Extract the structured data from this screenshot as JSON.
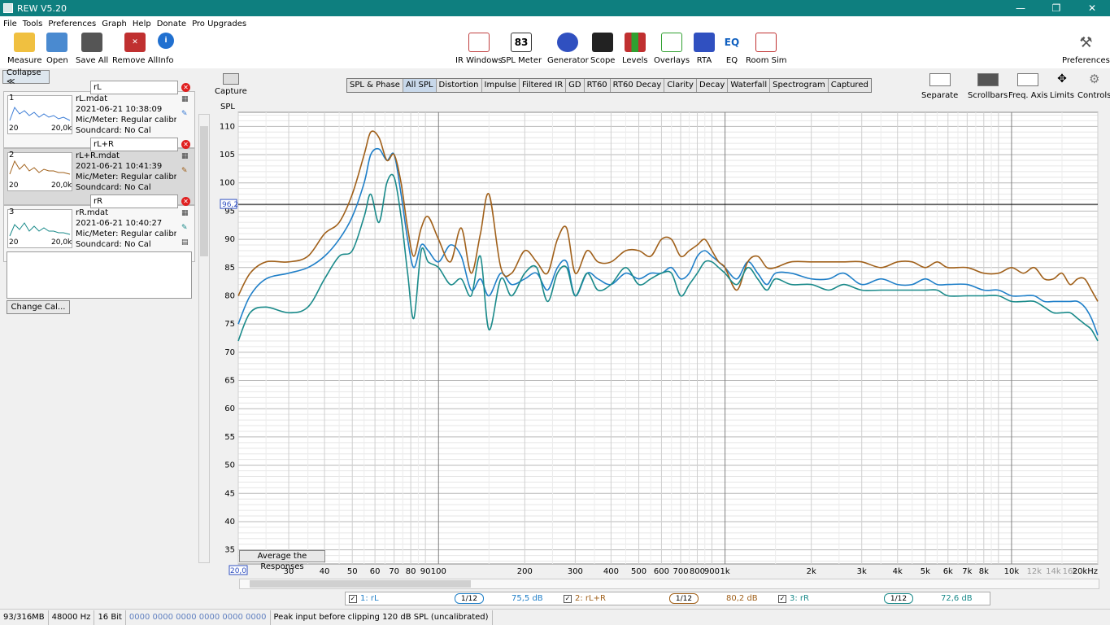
{
  "window": {
    "title": "REW V5.20",
    "min": "—",
    "max": "❐",
    "close": "✕"
  },
  "menu": [
    "File",
    "Tools",
    "Preferences",
    "Graph",
    "Help",
    "Donate",
    "Pro Upgrades"
  ],
  "toolbar_left": [
    {
      "label": "Measure",
      "icon": "measure-icon",
      "color": "#f0c040"
    },
    {
      "label": "Open",
      "icon": "folder-icon",
      "color": "#4a8ad0"
    },
    {
      "label": "Save All",
      "icon": "floppy-icon",
      "color": "#555555"
    },
    {
      "label": "Remove All",
      "icon": "remove-icon",
      "color": "#c03030"
    },
    {
      "label": "Info",
      "icon": "info-icon",
      "color": "#2070d0"
    }
  ],
  "toolbar_mid": [
    {
      "label": "IR Windows",
      "icon": "ir-windows-icon",
      "color": "#c04040"
    },
    {
      "label": "SPL Meter",
      "icon": "spl-meter-icon",
      "color": "#333333",
      "text": "83"
    },
    {
      "label": "Generator",
      "icon": "generator-icon",
      "color": "#3050c0"
    },
    {
      "label": "Scope",
      "icon": "scope-icon",
      "color": "#222222"
    },
    {
      "label": "Levels",
      "icon": "levels-icon",
      "color": "#c03030"
    },
    {
      "label": "Overlays",
      "icon": "overlays-icon",
      "color": "#30a030"
    },
    {
      "label": "RTA",
      "icon": "rta-icon",
      "color": "#3050c0"
    },
    {
      "label": "EQ",
      "icon": "eq-icon",
      "color": "#1060c0",
      "text": "EQ"
    },
    {
      "label": "Room Sim",
      "icon": "room-sim-icon",
      "color": "#c03030"
    }
  ],
  "toolbar_right": {
    "label": "Preferences",
    "icon": "wrench-icon"
  },
  "left_panel": {
    "collapse_label": "Collapse ≪",
    "measurements": [
      {
        "num": "1",
        "name_input": "rL",
        "file": "rL.mdat",
        "date": "2021-06-21 10:38:09",
        "mic": "Mic/Meter: Regular calibratior",
        "sound": "Soundcard: No Cal",
        "color": "#3a7bd5",
        "t20": "20",
        "t20k": "20,0k"
      },
      {
        "num": "2",
        "name_input": "rL+R",
        "file": "rL+R.mdat",
        "date": "2021-06-21 10:41:39",
        "mic": "Mic/Meter: Regular calibratior",
        "sound": "Soundcard: No Cal",
        "color": "#a0601a",
        "t20": "20",
        "t20k": "20,0k"
      },
      {
        "num": "3",
        "name_input": "rR",
        "file": "rR.mdat",
        "date": "2021-06-21 10:40:27",
        "mic": "Mic/Meter: Regular calibratior",
        "sound": "Soundcard: No Cal",
        "color": "#1a8a8a",
        "t20": "20",
        "t20k": "20,0k"
      }
    ],
    "change_cal_label": "Change Cal..."
  },
  "graph": {
    "capture_label": "Capture",
    "tabs": [
      "SPL & Phase",
      "All SPL",
      "Distortion",
      "Impulse",
      "Filtered IR",
      "GD",
      "RT60",
      "RT60 Decay",
      "Clarity",
      "Decay",
      "Waterfall",
      "Spectrogram",
      "Captured"
    ],
    "active_tab": "All SPL",
    "tools": [
      "Separate",
      "Scrollbars",
      "Freq. Axis",
      "Limits",
      "Controls"
    ],
    "avg_button": "Average the Responses",
    "cursor_value": "96,2",
    "x_start_label": "20,0"
  },
  "chart_data": {
    "type": "line",
    "ylabel": "SPL",
    "xlabel": "",
    "xscale": "log",
    "xlim": [
      20,
      20000
    ],
    "ylim": [
      32.5,
      112.5
    ],
    "yticks": [
      35,
      40,
      45,
      50,
      55,
      60,
      65,
      70,
      75,
      80,
      85,
      90,
      95,
      100,
      105,
      110
    ],
    "xtick_labels": [
      {
        "x": 30,
        "label": "30"
      },
      {
        "x": 40,
        "label": "40"
      },
      {
        "x": 50,
        "label": "50"
      },
      {
        "x": 60,
        "label": "60"
      },
      {
        "x": 70,
        "label": "70"
      },
      {
        "x": 80,
        "label": "80"
      },
      {
        "x": 90,
        "label": "90"
      },
      {
        "x": 100,
        "label": "100"
      },
      {
        "x": 200,
        "label": "200"
      },
      {
        "x": 300,
        "label": "300"
      },
      {
        "x": 400,
        "label": "400"
      },
      {
        "x": 500,
        "label": "500"
      },
      {
        "x": 600,
        "label": "600"
      },
      {
        "x": 700,
        "label": "700"
      },
      {
        "x": 800,
        "label": "800"
      },
      {
        "x": 900,
        "label": "900"
      },
      {
        "x": 1000,
        "label": "1k"
      },
      {
        "x": 2000,
        "label": "2k"
      },
      {
        "x": 3000,
        "label": "3k"
      },
      {
        "x": 4000,
        "label": "4k"
      },
      {
        "x": 5000,
        "label": "5k"
      },
      {
        "x": 6000,
        "label": "6k"
      },
      {
        "x": 7000,
        "label": "7k"
      },
      {
        "x": 8000,
        "label": "8k"
      },
      {
        "x": 10000,
        "label": "10k"
      },
      {
        "x": 12000,
        "label": "12k"
      },
      {
        "x": 14000,
        "label": "14k"
      },
      {
        "x": 16000,
        "label": "16k"
      },
      {
        "x": 20000,
        "label": "20kHz"
      }
    ],
    "cursor_y": 96.2,
    "series": [
      {
        "name": "rL",
        "color": "#1f7fc8",
        "x": [
          20,
          22,
          25,
          30,
          35,
          40,
          45,
          50,
          55,
          58,
          62,
          66,
          70,
          74,
          78,
          82,
          87,
          92,
          100,
          110,
          120,
          130,
          140,
          150,
          165,
          180,
          200,
          220,
          240,
          260,
          280,
          300,
          330,
          360,
          400,
          450,
          500,
          550,
          600,
          650,
          700,
          750,
          800,
          850,
          900,
          950,
          1000,
          1100,
          1200,
          1300,
          1400,
          1500,
          1700,
          2000,
          2300,
          2600,
          3000,
          3500,
          4000,
          4500,
          5000,
          5500,
          6000,
          7000,
          8000,
          9000,
          10000,
          11000,
          12000,
          13000,
          14000,
          15000,
          16000,
          17000,
          18000,
          19000,
          20000
        ],
        "y": [
          75,
          80,
          83,
          84,
          85,
          87,
          90,
          94,
          100,
          105,
          106,
          104,
          105,
          98,
          90,
          85,
          89,
          88,
          86,
          89,
          87,
          81,
          83,
          80,
          84,
          82,
          83,
          84,
          81,
          85,
          86,
          80,
          84,
          83,
          82,
          84,
          83,
          84,
          84,
          85,
          83,
          84,
          87,
          88,
          87,
          86,
          85,
          83,
          86,
          84,
          82,
          84,
          84,
          83,
          83,
          84,
          82,
          83,
          82,
          82,
          83,
          82,
          82,
          82,
          81,
          81,
          80,
          80,
          80,
          79,
          79,
          79,
          79,
          79,
          78,
          76,
          73
        ]
      },
      {
        "name": "rL+R",
        "color": "#a0601a",
        "x": [
          20,
          22,
          25,
          30,
          35,
          40,
          45,
          50,
          55,
          58,
          62,
          66,
          70,
          74,
          78,
          82,
          87,
          92,
          100,
          110,
          120,
          130,
          140,
          150,
          165,
          180,
          200,
          220,
          240,
          260,
          280,
          300,
          330,
          360,
          400,
          450,
          500,
          550,
          600,
          650,
          700,
          750,
          800,
          850,
          900,
          950,
          1000,
          1100,
          1200,
          1300,
          1400,
          1500,
          1700,
          2000,
          2300,
          2600,
          3000,
          3500,
          4000,
          4500,
          5000,
          5500,
          6000,
          7000,
          8000,
          9000,
          10000,
          11000,
          12000,
          13000,
          14000,
          15000,
          16000,
          17000,
          18000,
          19000,
          20000
        ],
        "y": [
          80,
          84,
          86,
          86,
          87,
          91,
          93,
          98,
          105,
          109,
          108,
          104,
          105,
          100,
          92,
          87,
          92,
          94,
          90,
          86,
          92,
          84,
          91,
          98,
          85,
          84,
          88,
          86,
          84,
          90,
          92,
          84,
          88,
          86,
          86,
          88,
          88,
          87,
          90,
          90,
          87,
          88,
          89,
          90,
          88,
          86,
          85,
          81,
          86,
          87,
          85,
          85,
          86,
          86,
          86,
          86,
          86,
          85,
          86,
          86,
          85,
          86,
          85,
          85,
          84,
          84,
          85,
          84,
          85,
          83,
          83,
          84,
          82,
          83,
          83,
          81,
          79
        ]
      },
      {
        "name": "rR",
        "color": "#1a8a8a",
        "x": [
          20,
          22,
          25,
          30,
          35,
          40,
          45,
          50,
          55,
          58,
          62,
          66,
          70,
          74,
          78,
          82,
          87,
          92,
          100,
          110,
          120,
          130,
          140,
          150,
          165,
          180,
          200,
          220,
          240,
          260,
          280,
          300,
          330,
          360,
          400,
          450,
          500,
          550,
          600,
          650,
          700,
          750,
          800,
          850,
          900,
          950,
          1000,
          1100,
          1200,
          1300,
          1400,
          1500,
          1700,
          2000,
          2300,
          2600,
          3000,
          3500,
          4000,
          4500,
          5000,
          5500,
          6000,
          7000,
          8000,
          9000,
          10000,
          11000,
          12000,
          13000,
          14000,
          15000,
          16000,
          17000,
          18000,
          19000,
          20000
        ],
        "y": [
          72,
          77,
          78,
          77,
          78,
          83,
          87,
          88,
          94,
          98,
          93,
          100,
          101,
          94,
          84,
          76,
          88,
          86,
          85,
          82,
          83,
          80,
          87,
          74,
          83,
          80,
          84,
          85,
          79,
          84,
          85,
          80,
          84,
          81,
          82,
          85,
          82,
          83,
          84,
          84,
          80,
          82,
          84,
          86,
          86,
          85,
          84,
          82,
          85,
          83,
          81,
          83,
          82,
          82,
          81,
          82,
          81,
          81,
          81,
          81,
          81,
          81,
          80,
          80,
          80,
          80,
          79,
          79,
          79,
          78,
          77,
          77,
          77,
          76,
          75,
          74,
          72
        ]
      }
    ]
  },
  "legend": [
    {
      "label": "1: rL",
      "smoothing": "1/12",
      "value": "75,5 dB",
      "color": "#1f7fc8"
    },
    {
      "label": "2: rL+R",
      "smoothing": "1/12",
      "value": "80,2 dB",
      "color": "#a0601a"
    },
    {
      "label": "3: rR",
      "smoothing": "1/12",
      "value": "72,6 dB",
      "color": "#1a8a8a"
    }
  ],
  "status": {
    "memory": "93/316MB",
    "rate": "48000 Hz",
    "bits": "16 Bit",
    "meters": "0000 0000  0000 0000  0000 0000",
    "message": "Peak input before clipping 120 dB SPL (uncalibrated)"
  }
}
